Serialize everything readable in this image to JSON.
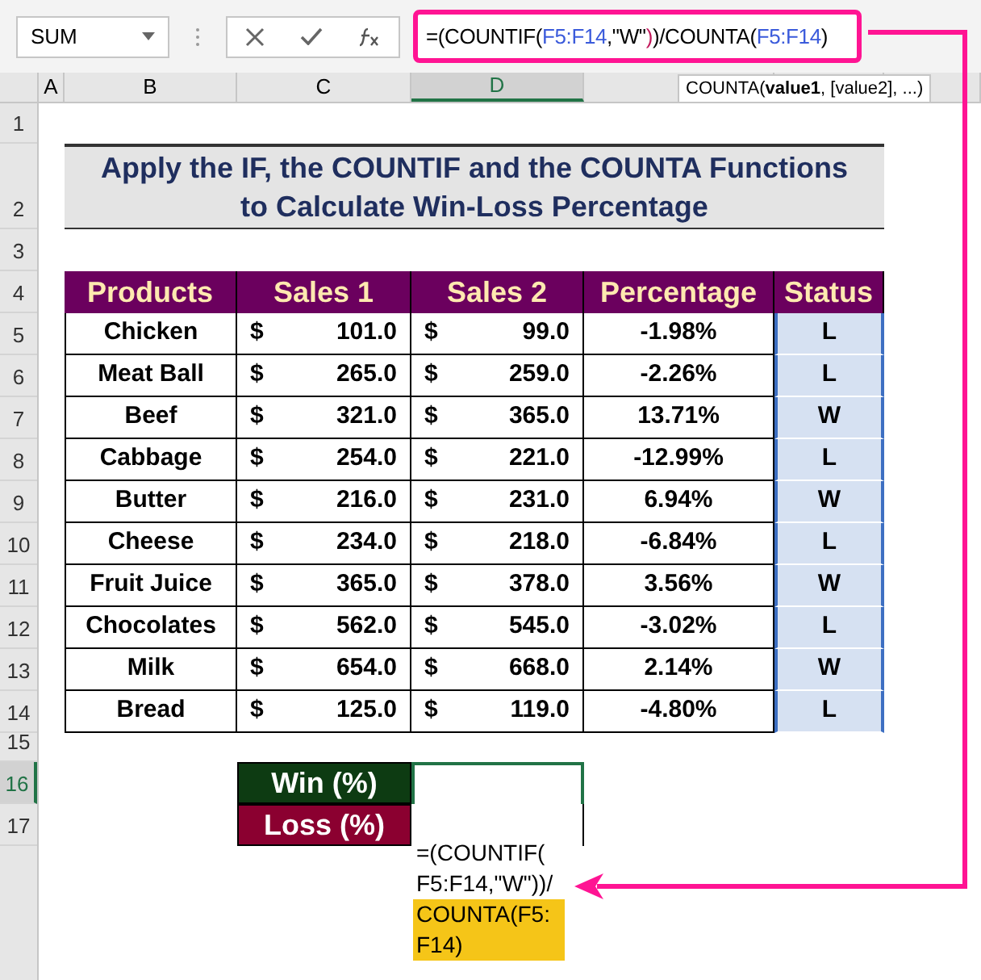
{
  "name_box": "SUM",
  "formula_bar": {
    "segments": [
      {
        "text": "=(COUNTIF(",
        "color": "#000000"
      },
      {
        "text": "F5:F14",
        "color": "#3b5bdb"
      },
      {
        "text": ",\"W\"",
        "color": "#000000"
      },
      {
        "text": ")",
        "color": "#c2185b"
      },
      {
        "text": ")/COUNTA(",
        "color": "#000000"
      },
      {
        "text": "F5:F14",
        "color": "#3b5bdb"
      },
      {
        "text": ")",
        "color": "#000000"
      }
    ]
  },
  "tooltip": "COUNTA(**value1**, [value2], ...)",
  "column_headers": [
    {
      "label": "A",
      "selected": false
    },
    {
      "label": "B",
      "selected": false
    },
    {
      "label": "C",
      "selected": false
    },
    {
      "label": "D",
      "selected": true
    }
  ],
  "row_numbers": [
    {
      "label": "1",
      "selected": false
    },
    {
      "label": "2",
      "selected": false
    },
    {
      "label": "3",
      "selected": false
    },
    {
      "label": "4",
      "selected": false
    },
    {
      "label": "5",
      "selected": false
    },
    {
      "label": "6",
      "selected": false
    },
    {
      "label": "7",
      "selected": false
    },
    {
      "label": "8",
      "selected": false
    },
    {
      "label": "9",
      "selected": false
    },
    {
      "label": "10",
      "selected": false
    },
    {
      "label": "11",
      "selected": false
    },
    {
      "label": "12",
      "selected": false
    },
    {
      "label": "13",
      "selected": false
    },
    {
      "label": "14",
      "selected": false
    },
    {
      "label": "15",
      "selected": false
    },
    {
      "label": "16",
      "selected": true
    },
    {
      "label": "17",
      "selected": false
    }
  ],
  "title": [
    "Apply the IF, the COUNTIF and the COUNTA Functions",
    "to Calculate Win-Loss Percentage"
  ],
  "table": {
    "columns": [
      "Products",
      "Sales 1",
      "Sales 2",
      "Percentage",
      "Status"
    ],
    "status_selected": true,
    "rows": [
      {
        "product": "Chicken",
        "sales_1": [
          "$",
          "101.0"
        ],
        "sales_2": [
          "$",
          "99.0"
        ],
        "percentage": "-1.98%",
        "status": "L"
      },
      {
        "product": "Meat Ball",
        "sales_1": [
          "$",
          "265.0"
        ],
        "sales_2": [
          "$",
          "259.0"
        ],
        "percentage": "-2.26%",
        "status": "L"
      },
      {
        "product": "Beef",
        "sales_1": [
          "$",
          "321.0"
        ],
        "sales_2": [
          "$",
          "365.0"
        ],
        "percentage": "13.71%",
        "status": "W"
      },
      {
        "product": "Cabbage",
        "sales_1": [
          "$",
          "254.0"
        ],
        "sales_2": [
          "$",
          "221.0"
        ],
        "percentage": "-12.99%",
        "status": "L"
      },
      {
        "product": "Butter",
        "sales_1": [
          "$",
          "216.0"
        ],
        "sales_2": [
          "$",
          "231.0"
        ],
        "percentage": "6.94%",
        "status": "W"
      },
      {
        "product": "Cheese",
        "sales_1": [
          "$",
          "234.0"
        ],
        "sales_2": [
          "$",
          "218.0"
        ],
        "percentage": "-6.84%",
        "status": "L"
      },
      {
        "product": "Fruit Juice",
        "sales_1": [
          "$",
          "365.0"
        ],
        "sales_2": [
          "$",
          "378.0"
        ],
        "percentage": "3.56%",
        "status": "W"
      },
      {
        "product": "Chocolates",
        "sales_1": [
          "$",
          "562.0"
        ],
        "sales_2": [
          "$",
          "545.0"
        ],
        "percentage": "-3.02%",
        "status": "L"
      },
      {
        "product": "Milk",
        "sales_1": [
          "$",
          "654.0"
        ],
        "sales_2": [
          "$",
          "668.0"
        ],
        "percentage": "2.14%",
        "status": "W"
      },
      {
        "product": "Bread",
        "sales_1": [
          "$",
          "125.0"
        ],
        "sales_2": [
          "$",
          "119.0"
        ],
        "percentage": "-4.80%",
        "status": "L"
      }
    ]
  },
  "summary": [
    {
      "label": "Win (%)",
      "color": "#0d3b12"
    },
    {
      "label": "Loss (%)",
      "color": "#8b0030"
    }
  ],
  "editing_cell": {
    "lines": [
      {
        "text": "=(COUNTIF(",
        "highlighted": false
      },
      {
        "text": "F5:F14,\"W\"))/",
        "highlighted": false
      },
      {
        "text": "COUNTA(F5:",
        "highlighted": true
      },
      {
        "text": "F14)",
        "highlighted": true
      }
    ]
  }
}
